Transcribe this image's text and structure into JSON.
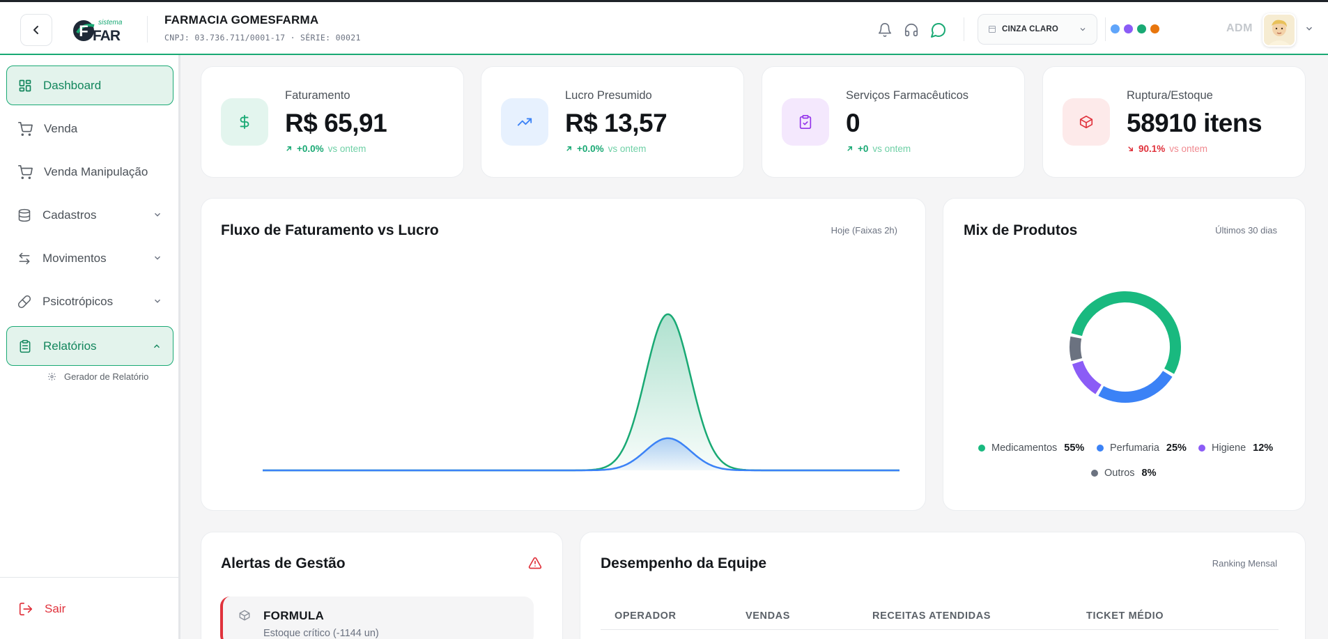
{
  "header": {
    "logo_small": "sistema",
    "logo_big": "FAR",
    "company_name": "FARMACIA GOMESFARMA",
    "company_sub": "CNPJ: 03.736.711/0001-17 · SÉRIE: 00021",
    "theme_label": "CINZA CLARO",
    "user": "ADM",
    "swatch_colors": [
      "#60a5fa",
      "#8b5cf6",
      "#19a974",
      "#e8760d"
    ]
  },
  "sidebar": {
    "items": [
      {
        "label": "Dashboard",
        "icon": "dashboard-grid-icon"
      },
      {
        "label": "Venda",
        "icon": "cart-icon"
      },
      {
        "label": "Venda Manipulação",
        "icon": "cart-icon"
      },
      {
        "label": "Cadastros",
        "icon": "database-icon"
      },
      {
        "label": "Movimentos",
        "icon": "arrows-swap-icon"
      },
      {
        "label": "Psicotrópicos",
        "icon": "pill-icon"
      },
      {
        "label": "Relatórios",
        "icon": "clipboard-icon"
      }
    ],
    "sub_item": "Gerador de Relatório",
    "logout": "Sair"
  },
  "kpis": [
    {
      "label": "Faturamento",
      "value": "R$ 65,91",
      "trend": "+0.0%",
      "vs": "vs ontem",
      "direction": "up"
    },
    {
      "label": "Lucro Presumido",
      "value": "R$ 13,57",
      "trend": "+0.0%",
      "vs": "vs ontem",
      "direction": "up"
    },
    {
      "label": "Serviços Farmacêuticos",
      "value": "0",
      "trend": "+0",
      "vs": "vs ontem",
      "direction": "up"
    },
    {
      "label": "Ruptura/Estoque",
      "value": "58910 itens",
      "trend": "90.1%",
      "vs": "vs ontem",
      "direction": "down"
    }
  ],
  "flow_card": {
    "title": "Fluxo de Faturamento vs Lucro",
    "meta": "Hoje (Faixas 2h)"
  },
  "mix_card": {
    "title": "Mix de Produtos",
    "meta": "Últimos 30 dias"
  },
  "alerts_card": {
    "title": "Alertas de Gestão",
    "item_title": "FORMULA",
    "item_desc": "Estoque crítico (-1144 un)"
  },
  "team_card": {
    "title": "Desempenho da Equipe",
    "meta": "Ranking Mensal",
    "columns": [
      "OPERADOR",
      "VENDAS",
      "RECEITAS ATENDIDAS",
      "TICKET MÉDIO"
    ]
  },
  "chart_data": [
    {
      "type": "area",
      "title": "Fluxo de Faturamento vs Lucro",
      "x": [
        0,
        1,
        2,
        3,
        4,
        5,
        6,
        7,
        8,
        9,
        10,
        11
      ],
      "series": [
        {
          "values": [
            0,
            0,
            0,
            0,
            0,
            0,
            0,
            65.91,
            0,
            0,
            0,
            0
          ],
          "color": "#19a974"
        },
        {
          "values": [
            0,
            0,
            0,
            0,
            0,
            0,
            0,
            13.57,
            0,
            0,
            0,
            0
          ],
          "color": "#3b82f6"
        }
      ],
      "ylim": [
        0,
        75
      ],
      "grid": false
    },
    {
      "type": "pie",
      "title": "Mix de Produtos",
      "categories": [
        "Medicamentos",
        "Perfumaria",
        "Higiene",
        "Outros"
      ],
      "values": [
        55,
        25,
        12,
        8
      ],
      "value_labels": [
        "55%",
        "25%",
        "12%",
        "8%"
      ],
      "colors": [
        "#19b97f",
        "#3b82f6",
        "#8b5cf6",
        "#6b7280"
      ]
    }
  ]
}
